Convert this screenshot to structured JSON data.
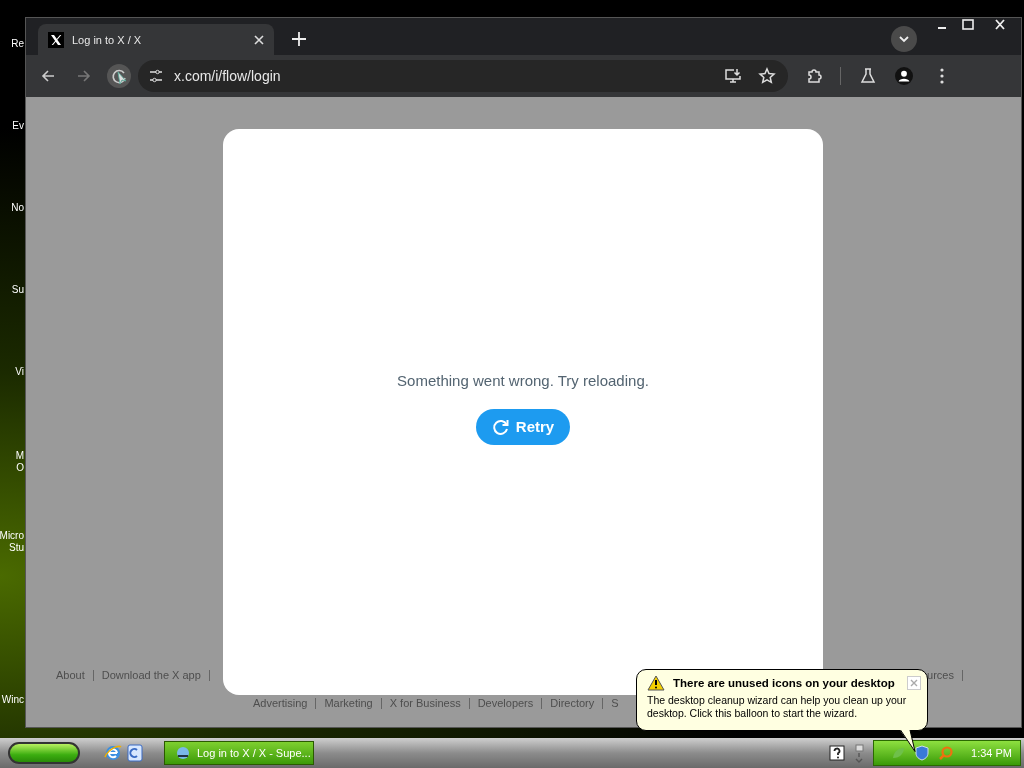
{
  "desktop_icons": [
    {
      "lines": [
        "Re"
      ]
    },
    {
      "lines": [
        "Ev"
      ]
    },
    {
      "lines": [
        "No"
      ]
    },
    {
      "lines": [
        "Su"
      ]
    },
    {
      "lines": [
        "Vi"
      ]
    },
    {
      "lines": [
        "M",
        "O"
      ]
    },
    {
      "lines": [
        "Micro",
        "Stu"
      ]
    },
    {
      "lines": [
        "Winc"
      ]
    }
  ],
  "browser": {
    "tabs": [
      {
        "title": "Log in to X / X",
        "selected": true
      }
    ],
    "address": "x.com/i/flow/login"
  },
  "dialog": {
    "message": "Something went wrong. Try reloading.",
    "button": "Retry"
  },
  "footer": {
    "row_1": [
      "About",
      "Download the X app",
      "urces"
    ],
    "row_2": [
      "Advertising",
      "Marketing",
      "X for Business",
      "Developers",
      "Directory",
      "S"
    ]
  },
  "balloon": {
    "title": "There are unused icons on your desktop",
    "body": "The desktop cleanup wizard can help you clean up your desktop. Click this balloon to start the wizard."
  },
  "taskbar": {
    "tasks": [
      {
        "label": "Log in to X / X - Supe...",
        "selected": true
      }
    ],
    "clock": "1:34 PM"
  }
}
